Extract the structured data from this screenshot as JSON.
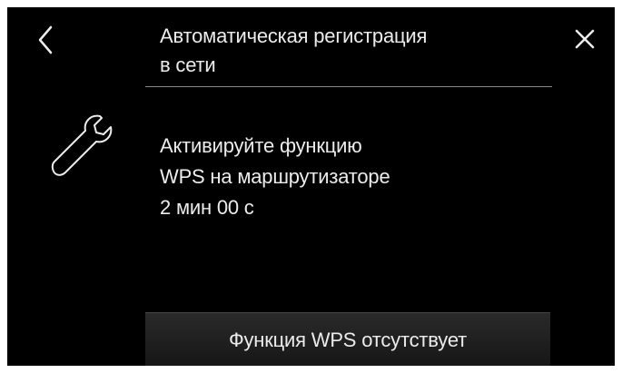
{
  "header": {
    "title_line1": "Автоматическая регистрация",
    "title_line2": "в сети",
    "back_icon": "chevron-left-icon",
    "close_icon": "close-icon"
  },
  "main": {
    "icon": "wrench-icon",
    "instruction_line1": "Активируйте функцию",
    "instruction_line2": "WPS на маршрутизаторе",
    "timer": "2 мин 00 с"
  },
  "footer": {
    "button_label": "Функция WPS отсутствует"
  },
  "colors": {
    "background": "#000000",
    "text": "#ececec",
    "divider": "#8a8a8a"
  }
}
